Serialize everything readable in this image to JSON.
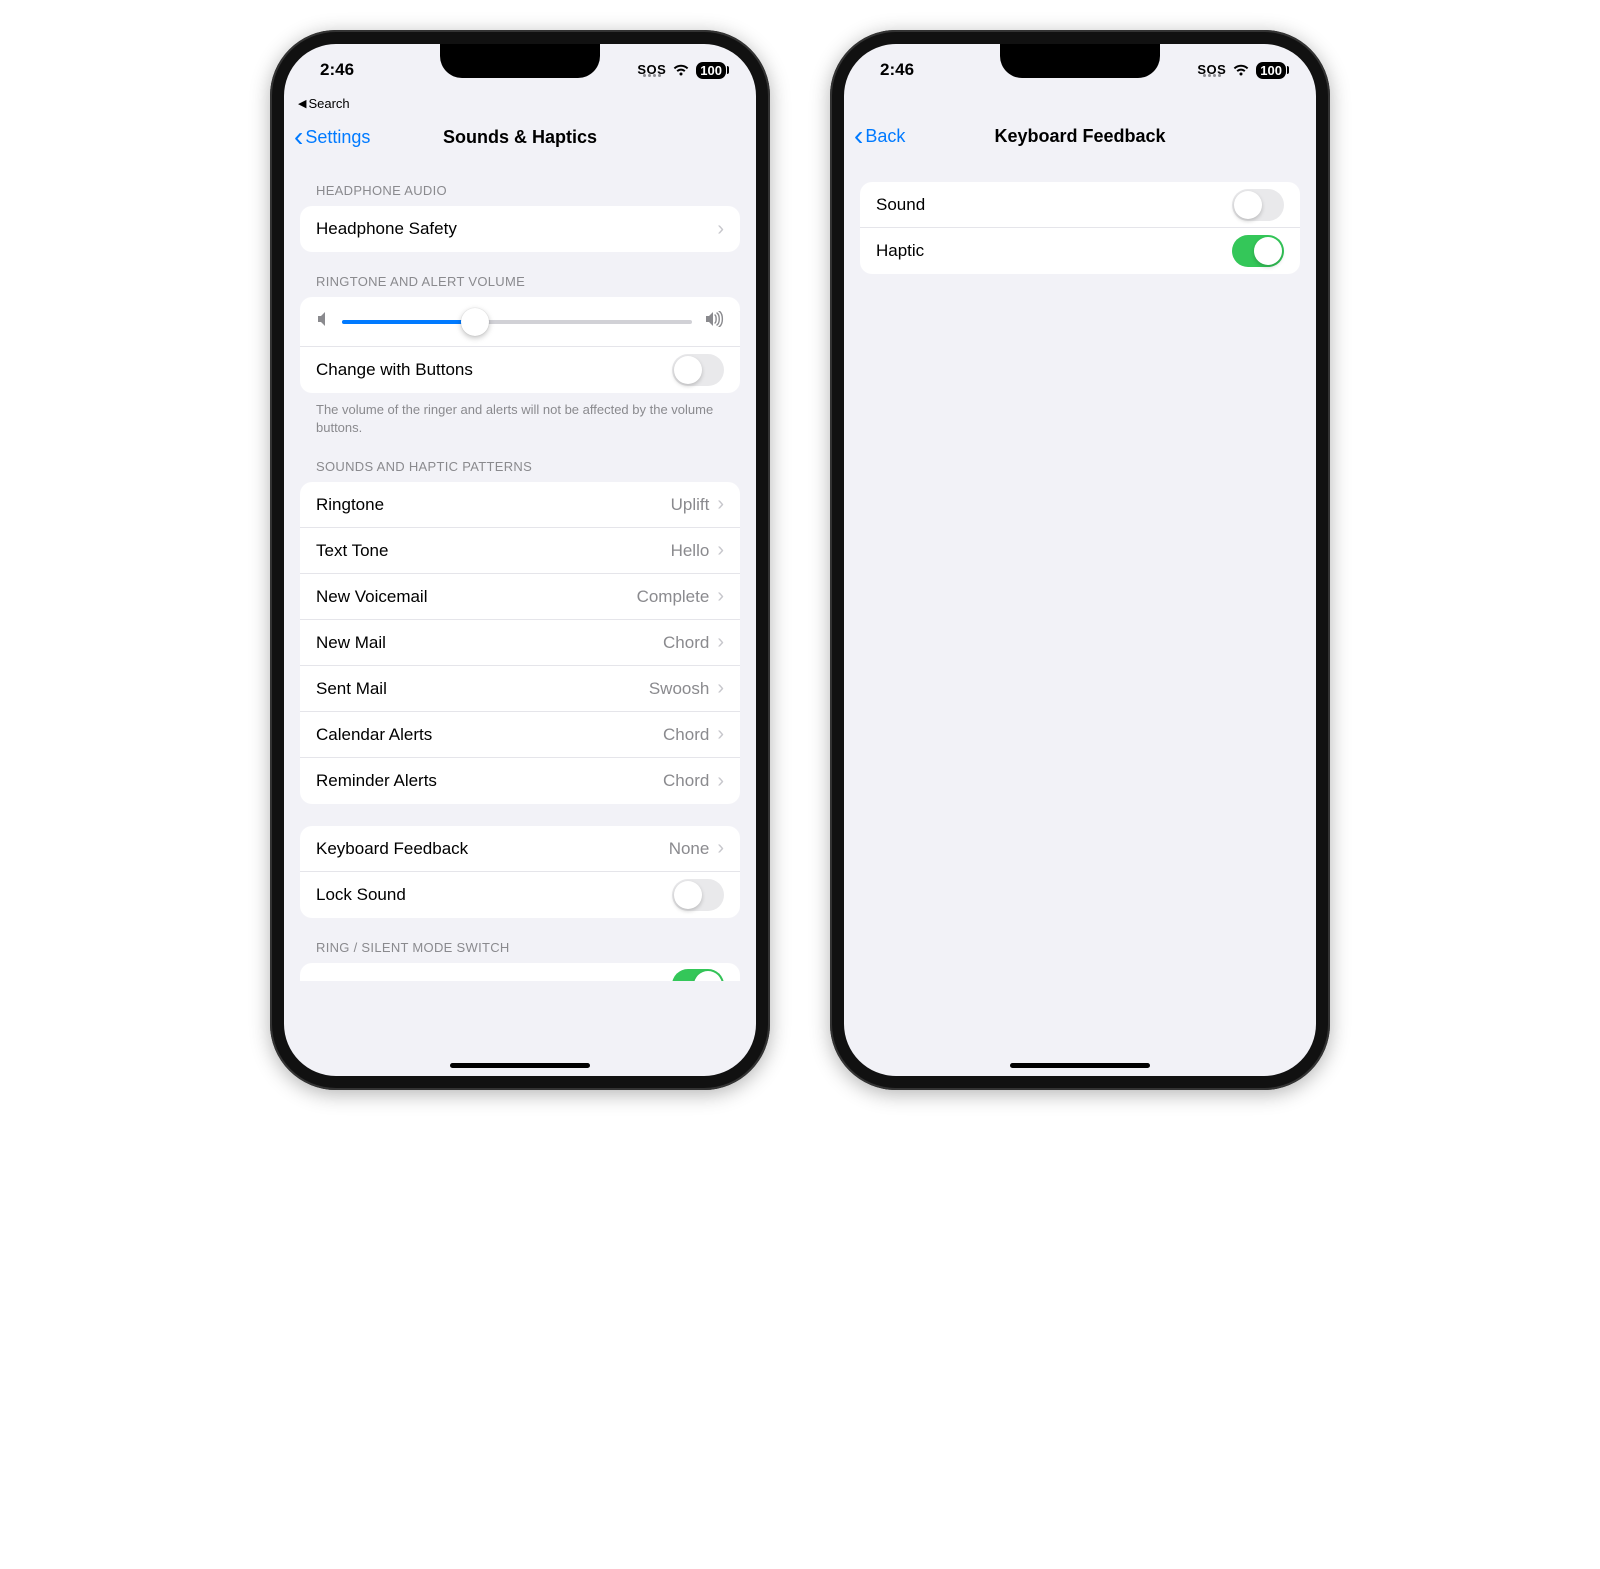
{
  "status": {
    "time": "2:46",
    "sos": "SOS",
    "battery": "100"
  },
  "left": {
    "breadcrumb": "Search",
    "nav_back": "Settings",
    "nav_title": "Sounds & Haptics",
    "sections": {
      "headphone": {
        "header": "HEADPHONE AUDIO",
        "item": "Headphone Safety"
      },
      "volume": {
        "header": "RINGTONE AND ALERT VOLUME",
        "change_label": "Change with Buttons",
        "change_on": false,
        "footer": "The volume of the ringer and alerts will not be affected by the volume buttons."
      },
      "patterns": {
        "header": "SOUNDS AND HAPTIC PATTERNS",
        "items": [
          {
            "label": "Ringtone",
            "value": "Uplift"
          },
          {
            "label": "Text Tone",
            "value": "Hello"
          },
          {
            "label": "New Voicemail",
            "value": "Complete"
          },
          {
            "label": "New Mail",
            "value": "Chord"
          },
          {
            "label": "Sent Mail",
            "value": "Swoosh"
          },
          {
            "label": "Calendar Alerts",
            "value": "Chord"
          },
          {
            "label": "Reminder Alerts",
            "value": "Chord"
          }
        ]
      },
      "keyboard": {
        "feedback_label": "Keyboard Feedback",
        "feedback_value": "None",
        "lock_label": "Lock Sound",
        "lock_on": false
      },
      "ring_switch": {
        "header": "RING / SILENT MODE SWITCH"
      }
    }
  },
  "right": {
    "nav_back": "Back",
    "nav_title": "Keyboard Feedback",
    "rows": [
      {
        "label": "Sound",
        "on": false
      },
      {
        "label": "Haptic",
        "on": true
      }
    ]
  }
}
